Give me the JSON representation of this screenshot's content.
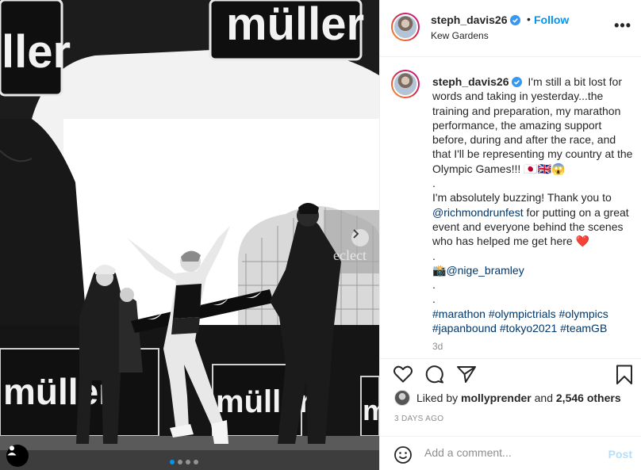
{
  "post": {
    "username": "steph_davis26",
    "follow_label": "Follow",
    "location": "Kew Gardens",
    "more_label": "•••",
    "image_alt": "Runner crossing finish line under Müller arch"
  },
  "photo": {
    "arch_text_top_left": "ller",
    "arch_text_top_right": "müller",
    "banner_left": "müller",
    "banner_mid": "müller",
    "banner_right": "mül",
    "watermark": "eclect"
  },
  "caption": {
    "username": "steph_davis26",
    "lines": [
      "I'm still a bit lost for words and taking in yesterday...the training and preparation, my marathon performance, the amazing support before, during and after the race, and that I'll be representing my country at the Olympic Games!!! 🇯🇵🇬🇧😱",
      ".",
      "I'm absolutely buzzing! Thank you to",
      "@richmondrunfest",
      "for putting on a great event and everyone behind the scenes who has helped me get here ❤️",
      ".",
      "📸",
      "@nige_bramley",
      ".",
      ".",
      "#marathon #olympictrials #olympics #japanbound #tokyo2021 #teamGB"
    ],
    "time_ago": "3d"
  },
  "likes": {
    "prefix": "Liked by",
    "liker": "mollyprender",
    "joiner": "and",
    "others": "2,546 others"
  },
  "date": "3 DAYS AGO",
  "comment": {
    "placeholder": "Add a comment...",
    "post_label": "Post"
  },
  "colors": {
    "accent": "#0095f6",
    "link": "#00376b",
    "muted": "#8e8e8e"
  }
}
